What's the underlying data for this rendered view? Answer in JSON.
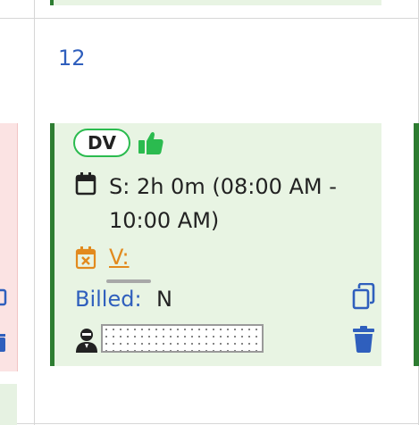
{
  "calendar": {
    "day_number": "12"
  },
  "event": {
    "status_badge": "DV",
    "duration": "S: 2h 0m (08:00 AM - 10:00 AM)",
    "visit_link": "V:",
    "billed_label": "Billed:",
    "billed_value": "N",
    "icons": [
      "thumbs-up-icon",
      "calendar-icon",
      "calendar-cancel-icon",
      "copy-icon",
      "user-icon",
      "trash-icon"
    ]
  },
  "colors": {
    "card_background": "#e8f4e3",
    "card_accent": "#2e7d32",
    "badge_border": "#2bbb4f",
    "link_blue": "#2f5fbd",
    "visit_orange": "#e28a1e",
    "prev_card_background": "#fbe3e3"
  }
}
